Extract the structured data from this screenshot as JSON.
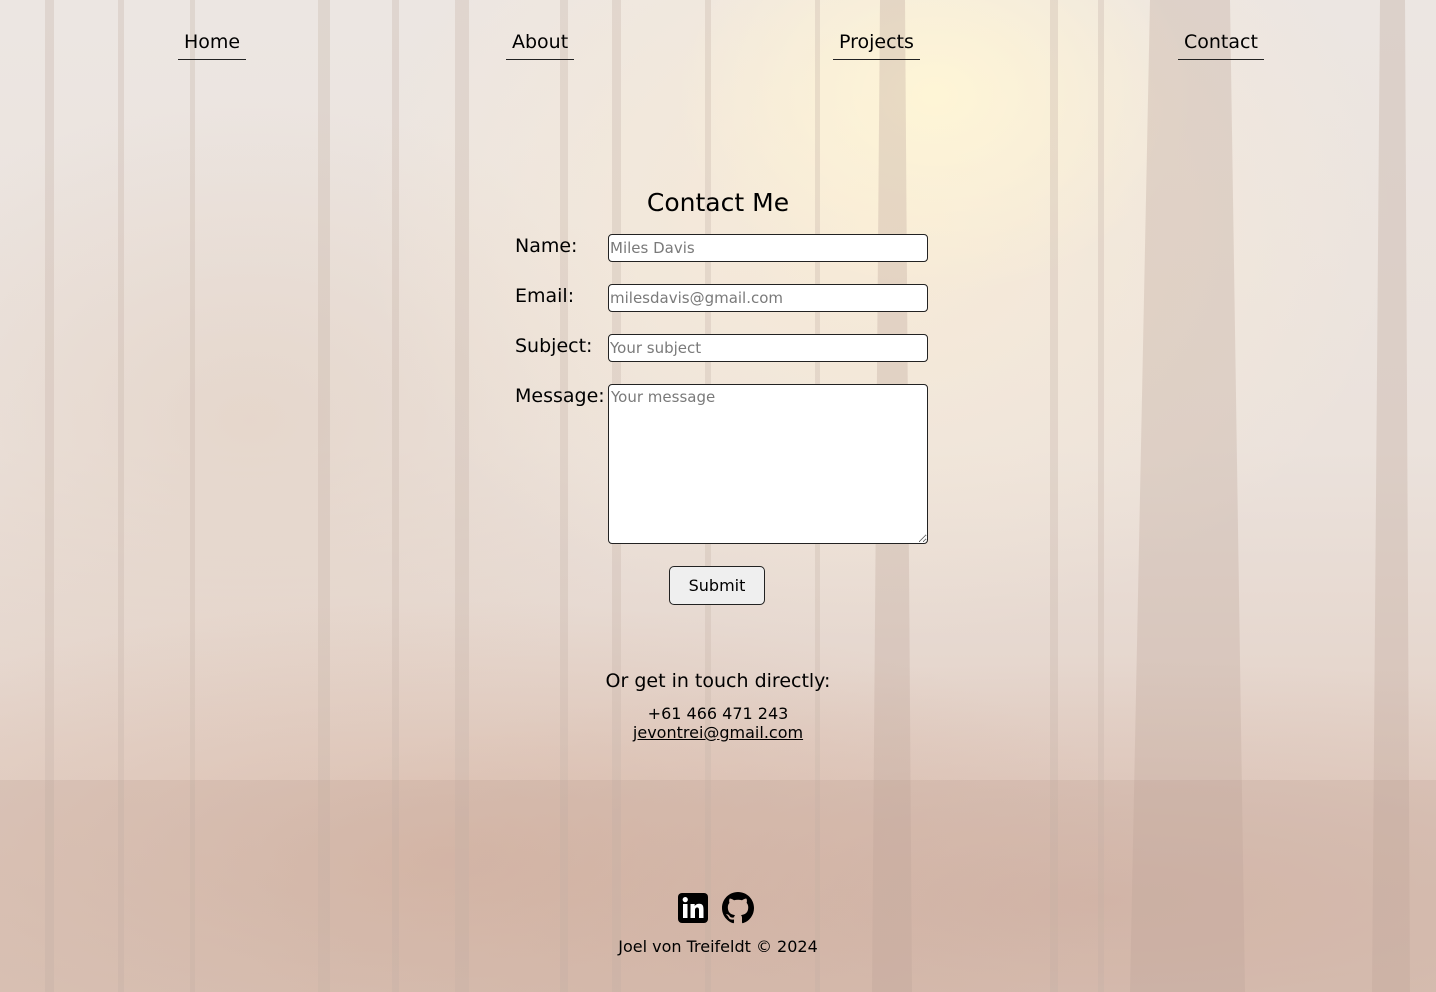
{
  "nav": {
    "home": "Home",
    "about": "About",
    "projects": "Projects",
    "contact": "Contact"
  },
  "contact_form": {
    "title": "Contact Me",
    "name_label": "Name:",
    "name_placeholder": "Miles Davis",
    "email_label": "Email:",
    "email_placeholder": "milesdavis@gmail.com",
    "subject_label": "Subject:",
    "subject_placeholder": "Your subject",
    "message_label": "Message:",
    "message_placeholder": "Your message",
    "submit_label": "Submit"
  },
  "direct": {
    "heading": "Or get in touch directly:",
    "phone": "+61 466 471 243",
    "email": "jevontrei@gmail.com"
  },
  "social": {
    "icons": [
      "linkedin-icon",
      "github-icon"
    ]
  },
  "footer": {
    "text": "Joel von Treifeldt © 2024"
  },
  "colors": {
    "text": "#000000",
    "input_bg": "#ffffff",
    "button_bg": "#efefef",
    "placeholder": "#7a7a7a"
  }
}
